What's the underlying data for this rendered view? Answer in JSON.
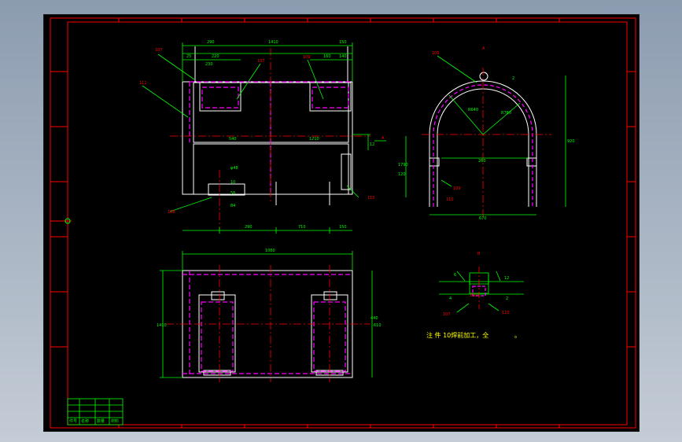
{
  "colors": {
    "background_gradient_top": "#8c9cb0",
    "background_gradient_bottom": "#c4ccd6",
    "canvas": "#000000",
    "frame": "#ff0000",
    "outline": "#ffffff",
    "dimension": "#00ff00",
    "hidden": "#ff00ff",
    "center": "#ff0000",
    "leader": "#00ff00",
    "balloon_text": "#ff0000",
    "note_text": "#ffff00",
    "title_block": "#00ff00"
  },
  "labels": {
    "view_a": "A",
    "view_b": "B",
    "note": "注  件 10焊前加工，全",
    "note_dot": "。"
  },
  "front_view": {
    "top_dims": [
      "290",
      "1410",
      "150"
    ],
    "upper_dims": [
      "25",
      "220",
      "160",
      "140",
      "230"
    ],
    "mid_dim_left": "540",
    "mid_dim_right": "1210",
    "bottom_dims": [
      "290",
      "710",
      "150"
    ],
    "side_dim": "12",
    "left_small_dims": [
      "φ48",
      "10",
      "56",
      "84"
    ],
    "balloons": [
      "107",
      "107",
      "109",
      "111",
      "108",
      "110"
    ],
    "right_marker": "A"
  },
  "side_view": {
    "balloons": [
      "105",
      "109",
      "110"
    ],
    "dims": [
      "R780",
      "R640",
      "260",
      "920",
      "670",
      "1790",
      "120",
      "2"
    ]
  },
  "top_view": {
    "dims": [
      "1060",
      "1410",
      "610",
      "440"
    ]
  },
  "detail_b": {
    "balloons": [
      "107",
      "110",
      "110"
    ],
    "dims": [
      "6",
      "12",
      "4",
      "2"
    ]
  },
  "title_block": {
    "cells": [
      "件号",
      "名称",
      "数量",
      "材料"
    ]
  }
}
